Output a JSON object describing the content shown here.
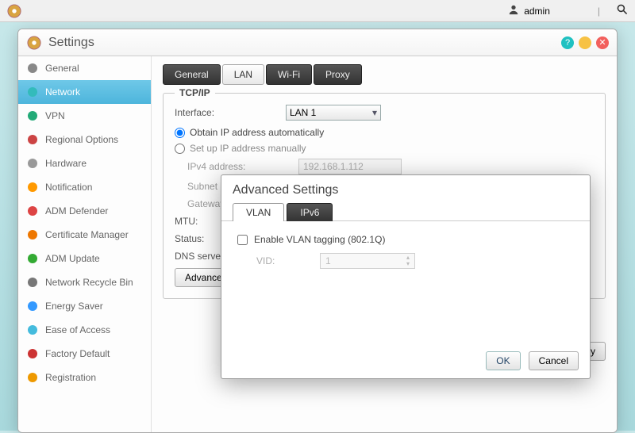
{
  "topbar": {
    "user_label": "admin"
  },
  "window": {
    "title": "Settings"
  },
  "sidebar": {
    "items": [
      {
        "label": "General",
        "color": "#888"
      },
      {
        "label": "Network",
        "color": "#3bb"
      },
      {
        "label": "VPN",
        "color": "#2a7"
      },
      {
        "label": "Regional Options",
        "color": "#c44"
      },
      {
        "label": "Hardware",
        "color": "#999"
      },
      {
        "label": "Notification",
        "color": "#f90"
      },
      {
        "label": "ADM Defender",
        "color": "#d44"
      },
      {
        "label": "Certificate Manager",
        "color": "#e70"
      },
      {
        "label": "ADM Update",
        "color": "#3a3"
      },
      {
        "label": "Network Recycle Bin",
        "color": "#777"
      },
      {
        "label": "Energy Saver",
        "color": "#39f"
      },
      {
        "label": "Ease of Access",
        "color": "#4bd"
      },
      {
        "label": "Factory Default",
        "color": "#c33"
      },
      {
        "label": "Registration",
        "color": "#e90"
      }
    ]
  },
  "tabs": [
    "General",
    "LAN",
    "Wi-Fi",
    "Proxy"
  ],
  "tcpip": {
    "legend": "TCP/IP",
    "interface_label": "Interface:",
    "interface_value": "LAN 1",
    "radio_auto": "Obtain IP address automatically",
    "radio_manual": "Set up IP address manually",
    "ipv4_label": "IPv4 address:",
    "ipv4_value": "192.168.1.112",
    "subnet_label": "Subnet mask:",
    "gateway_label": "Gateway:",
    "mtu_label": "MTU:",
    "status_label": "Status:",
    "dns_label": "DNS server:",
    "advanced_btn": "Advanced Settings"
  },
  "apply_label": "Apply",
  "modal": {
    "title": "Advanced Settings",
    "tabs": [
      "VLAN",
      "IPv6"
    ],
    "enable_label": "Enable VLAN tagging (802.1Q)",
    "vid_label": "VID:",
    "vid_value": "1",
    "ok": "OK",
    "cancel": "Cancel"
  }
}
